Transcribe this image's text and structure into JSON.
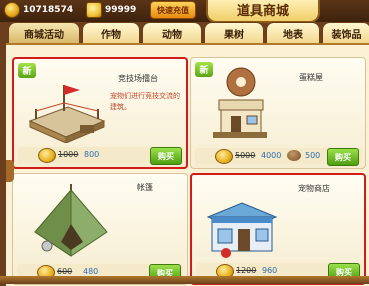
{
  "topbar": {
    "coins": "10718574",
    "gems": "99999",
    "recharge_label": "快速充值",
    "shop_title": "道具商城"
  },
  "tabs": [
    {
      "label": "商城活动",
      "active": true
    },
    {
      "label": "作物",
      "active": false
    },
    {
      "label": "动物",
      "active": false
    },
    {
      "label": "果树",
      "active": false
    },
    {
      "label": "地表",
      "active": false
    },
    {
      "label": "装饰品",
      "active": false
    }
  ],
  "items": [
    {
      "name": "竞技场擂台",
      "desc": "宠物们进行竞技交流的建筑。",
      "is_new": true,
      "new_label": "新",
      "old_price": "1000",
      "price": "800",
      "buy_label": "购买",
      "highlighted": true
    },
    {
      "name": "蛋糕屋",
      "desc": "",
      "is_new": true,
      "new_label": "新",
      "old_price": "5000",
      "price": "4000",
      "seed_price": "500",
      "buy_label": "购买",
      "highlighted": false
    },
    {
      "name": "帐篷",
      "desc": "",
      "is_new": false,
      "old_price": "600",
      "price": "480",
      "buy_label": "购买",
      "highlighted": false
    },
    {
      "name": "宠物商店",
      "desc": "",
      "is_new": false,
      "old_price": "1200",
      "price": "960",
      "buy_label": "购买",
      "highlighted": true
    }
  ],
  "colors": {
    "highlight": "#d21c1c",
    "buy_button": "#5aa414",
    "new_badge": "#7cc22a"
  }
}
